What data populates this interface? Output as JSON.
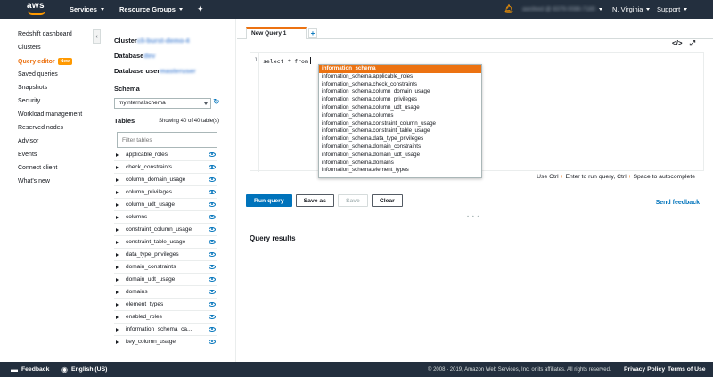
{
  "topbar": {
    "logo_text": "aws",
    "services_label": "Services",
    "resource_groups_label": "Resource Groups",
    "account_label": "awsfeed @ 8379-0086-7180",
    "region_label": "N. Virginia",
    "support_label": "Support"
  },
  "sidebar": {
    "items": [
      {
        "label": "Redshift dashboard"
      },
      {
        "label": "Clusters"
      },
      {
        "label": "Query editor",
        "badge": "New"
      },
      {
        "label": "Saved queries"
      },
      {
        "label": "Snapshots"
      },
      {
        "label": "Security"
      },
      {
        "label": "Workload management"
      },
      {
        "label": "Reserved nodes"
      },
      {
        "label": "Advisor"
      },
      {
        "label": "Events"
      },
      {
        "label": "Connect client"
      },
      {
        "label": "What's new"
      }
    ]
  },
  "connection": {
    "cluster_label": "Cluster",
    "cluster_value": "cli-burst-demo-4",
    "database_label": "Database",
    "database_value": "dev",
    "database_user_label": "Database user",
    "database_user_value": "masteruser"
  },
  "schema": {
    "label": "Schema",
    "selected": "myinternalschema"
  },
  "tables": {
    "label": "Tables",
    "count_text": "Showing 40 of 40 table(s)",
    "filter_placeholder": "Filter tables",
    "rows": [
      "applicable_roles",
      "check_constraints",
      "column_domain_usage",
      "column_privileges",
      "column_udt_usage",
      "columns",
      "constraint_column_usage",
      "constraint_table_usage",
      "data_type_privileges",
      "domain_constraints",
      "domain_udt_usage",
      "domains",
      "element_types",
      "enabled_roles",
      "information_schema_ca...",
      "key_column_usage"
    ]
  },
  "editor": {
    "tab_label": "New Query 1",
    "add_tab_label": "+",
    "line_number": "1",
    "code": "select * from",
    "autocomplete": [
      "information_schema",
      "information_schema.applicable_roles",
      "information_schema.check_constraints",
      "information_schema.column_domain_usage",
      "information_schema.column_privileges",
      "information_schema.column_udt_usage",
      "information_schema.columns",
      "information_schema.constraint_column_usage",
      "information_schema.constraint_table_usage",
      "information_schema.data_type_privileges",
      "information_schema.domain_constraints",
      "information_schema.domain_udt_usage",
      "information_schema.domains",
      "information_schema.element_types"
    ],
    "hint_prefix": "Use Ctrl",
    "hint_plus": "+",
    "hint_middle": "Enter to run query, Ctrl",
    "hint_suffix": "Space to autocomplete",
    "code_icon": "</>",
    "expand_icon": "⤢"
  },
  "actions": {
    "run_query": "Run query",
    "save_as": "Save as",
    "save": "Save",
    "clear": "Clear",
    "send_feedback": "Send feedback"
  },
  "results": {
    "title": "Query results"
  },
  "footer": {
    "feedback": "Feedback",
    "language": "English (US)",
    "copyright": "© 2008 - 2019, Amazon Web Services, Inc. or its affiliates. All rights reserved.",
    "privacy": "Privacy Policy",
    "terms": "Terms of Use"
  },
  "colors": {
    "topbar_bg": "#232f3e",
    "accent_orange": "#ec7211",
    "link_blue": "#0073bb"
  }
}
